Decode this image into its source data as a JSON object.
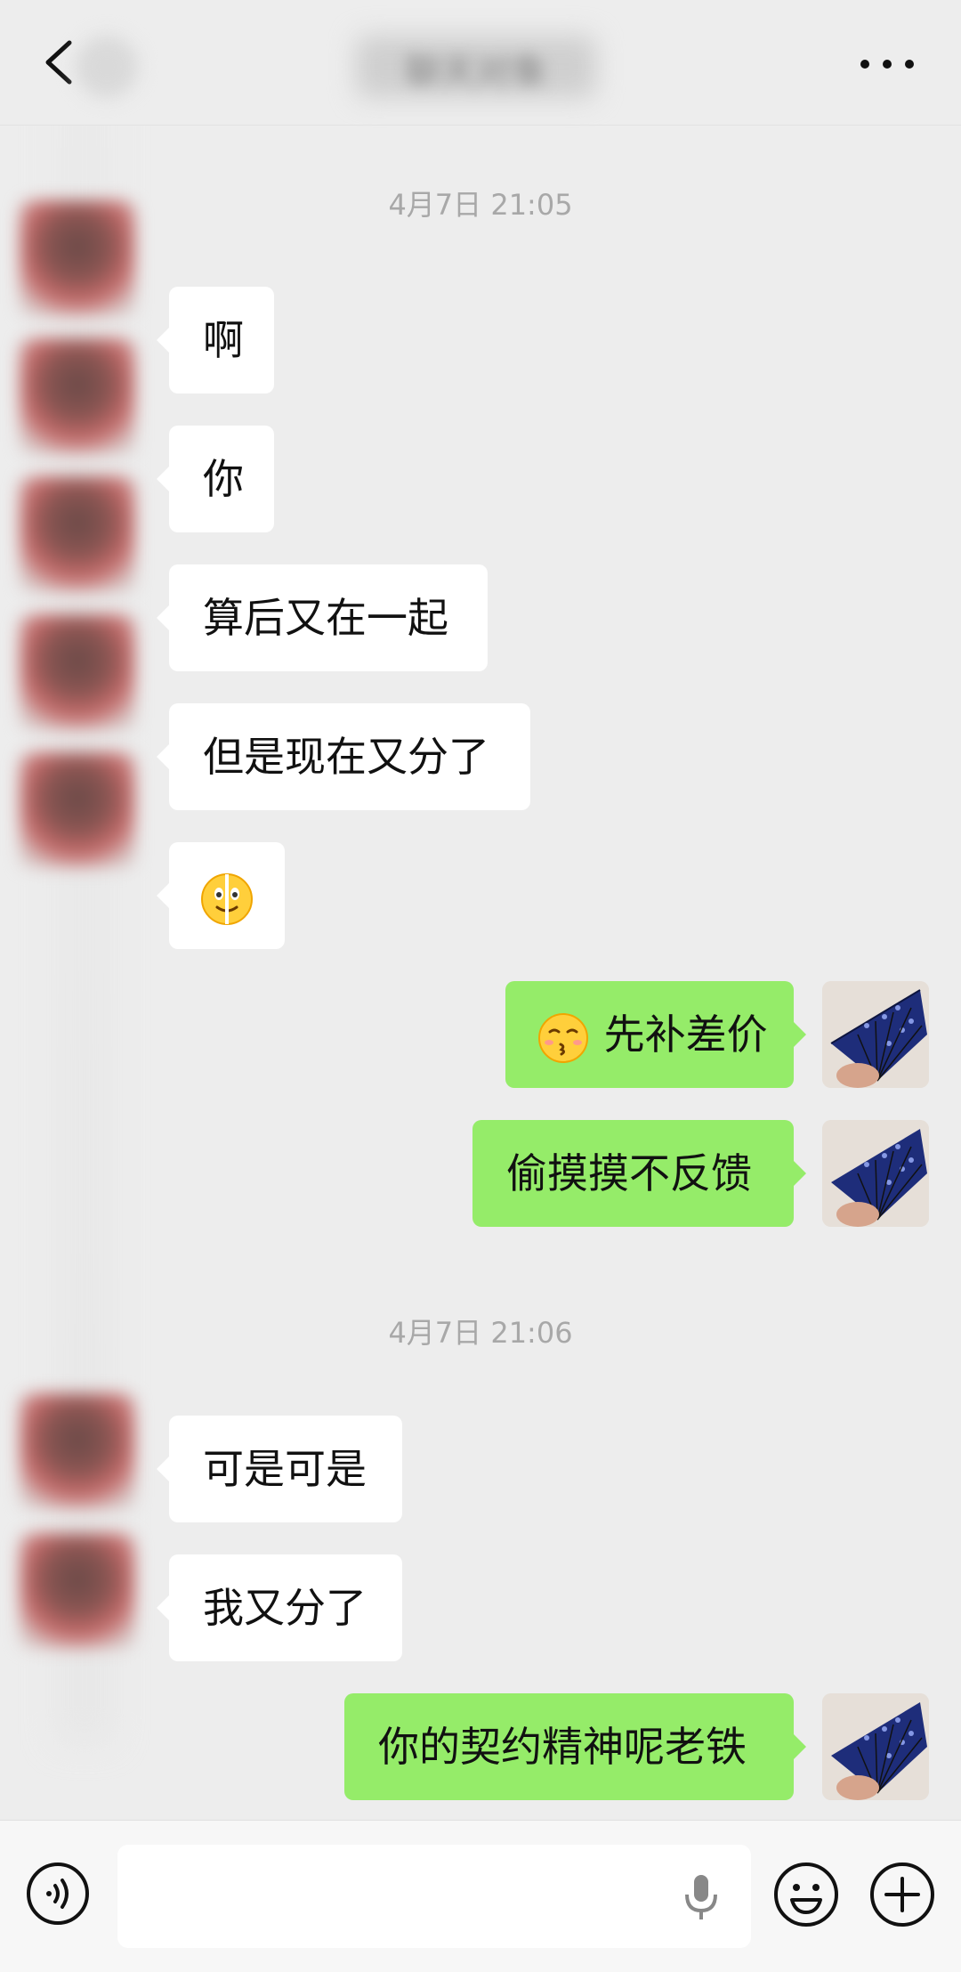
{
  "header": {
    "title": "聊天对象",
    "back_icon": "chevron-left-icon",
    "more_icon": "more-horizontal-icon"
  },
  "messages": [
    {
      "type": "timestamp",
      "text": "4月7日 21:05"
    },
    {
      "type": "left",
      "text": "啊"
    },
    {
      "type": "left",
      "text": "你"
    },
    {
      "type": "left",
      "text": "算后又在一起"
    },
    {
      "type": "left",
      "text": "但是现在又分了",
      "emoji": null
    },
    {
      "type": "left",
      "text": "",
      "emoji": "melting-face-emoji"
    },
    {
      "type": "right",
      "text": "先补差价",
      "emoji": "kissing-face-emoji"
    },
    {
      "type": "right",
      "text": "偷摸摸不反馈"
    },
    {
      "type": "timestamp",
      "text": "4月7日 21:06"
    },
    {
      "type": "left",
      "text": "可是可是"
    },
    {
      "type": "left",
      "text": "我又分了"
    },
    {
      "type": "right",
      "text": "你的契约精神呢老铁"
    }
  ],
  "composer": {
    "voice_icon": "voice-icon",
    "mic_icon": "microphone-icon",
    "emoji_icon": "smiley-icon",
    "plus_icon": "plus-circle-icon",
    "input_value": ""
  },
  "colors": {
    "background": "#ededed",
    "bubble_left": "#ffffff",
    "bubble_right": "#95ec69",
    "timestamp": "#a8a8a8"
  }
}
